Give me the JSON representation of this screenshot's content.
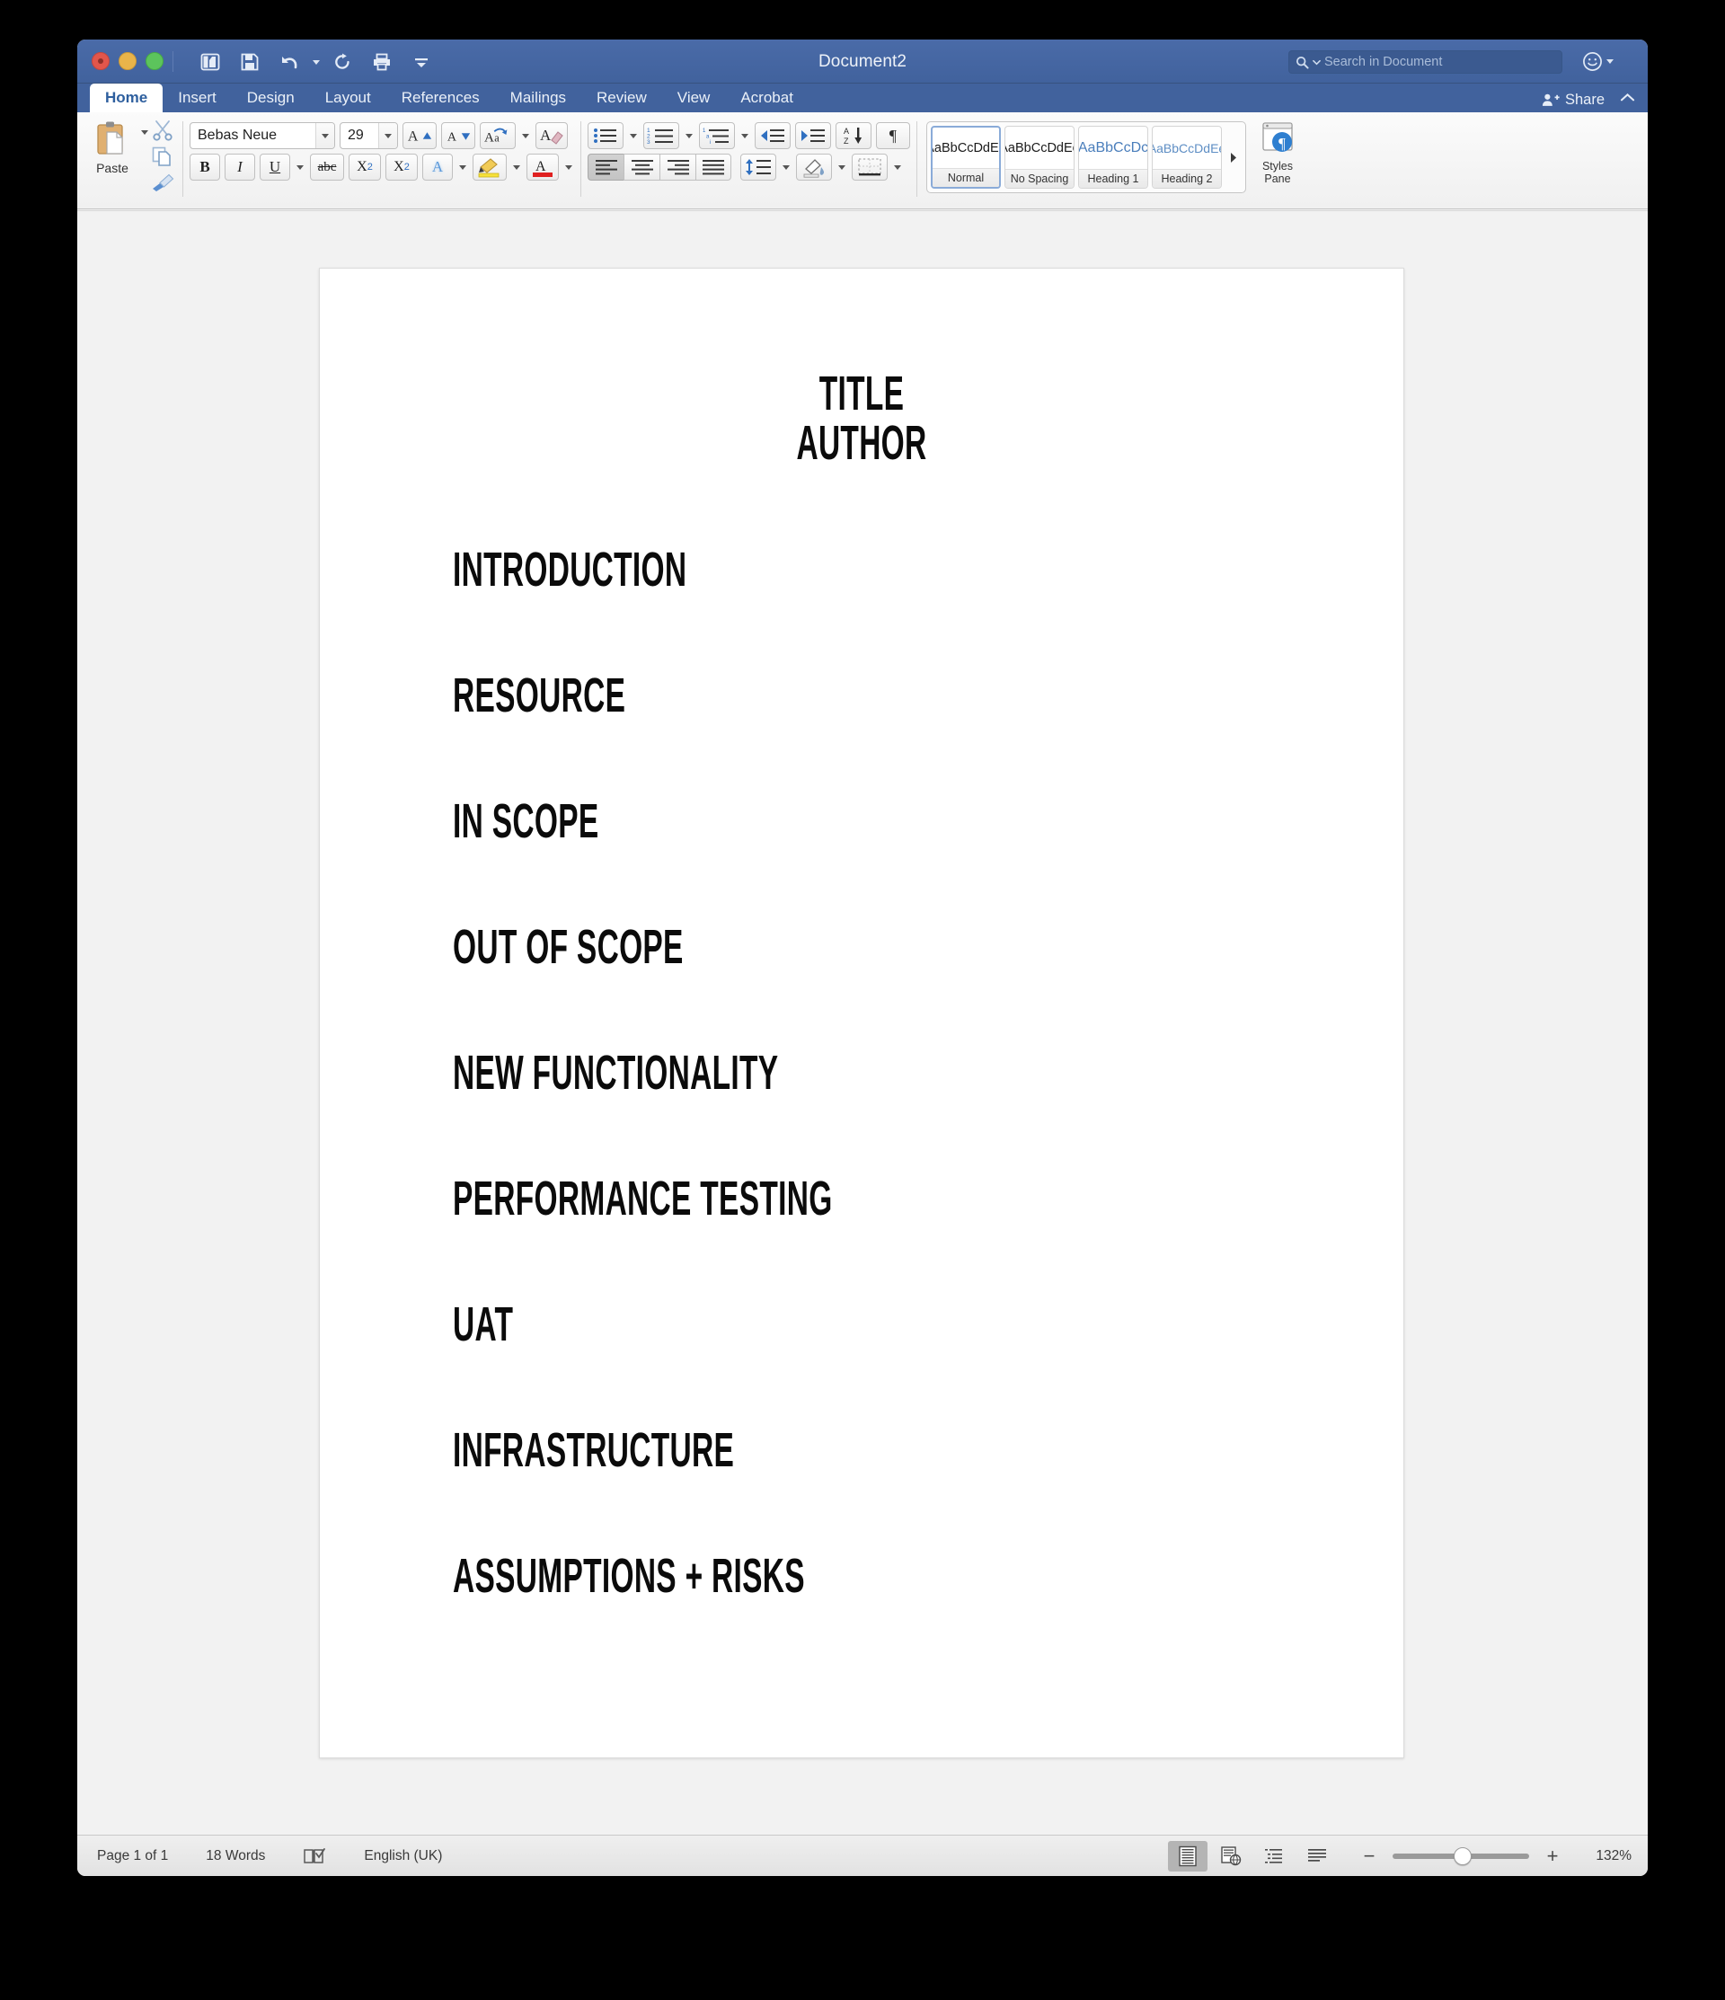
{
  "window": {
    "title": "Document2",
    "traffic_lights": [
      "close",
      "minimize",
      "zoom"
    ]
  },
  "quick_access": [
    {
      "name": "sidebar-toggle-icon",
      "label": "Sidebar"
    },
    {
      "name": "save-icon",
      "label": "Save"
    },
    {
      "name": "undo-icon",
      "label": "Undo"
    },
    {
      "name": "redo-icon",
      "label": "Redo"
    },
    {
      "name": "print-icon",
      "label": "Print"
    },
    {
      "name": "customize-toolbar-icon",
      "label": "Customize Toolbar"
    }
  ],
  "search": {
    "placeholder": "Search in Document",
    "value": ""
  },
  "account": {
    "smiley_icon": "smiley-icon"
  },
  "tabs": [
    {
      "label": "Home",
      "active": true
    },
    {
      "label": "Insert",
      "active": false
    },
    {
      "label": "Design",
      "active": false
    },
    {
      "label": "Layout",
      "active": false
    },
    {
      "label": "References",
      "active": false
    },
    {
      "label": "Mailings",
      "active": false
    },
    {
      "label": "Review",
      "active": false
    },
    {
      "label": "View",
      "active": false
    },
    {
      "label": "Acrobat",
      "active": false
    }
  ],
  "share": {
    "label": "Share"
  },
  "ribbon": {
    "clipboard": {
      "paste_label": "Paste",
      "cut_label": "Cut",
      "copy_label": "Copy",
      "format_painter_label": "Format Painter"
    },
    "font": {
      "family": "Bebas Neue",
      "size": "29",
      "grow_label": "Grow Font",
      "shrink_label": "Shrink Font",
      "change_case_label": "Change Case",
      "clear_formatting_label": "Clear Formatting",
      "bold_label": "B",
      "italic_label": "I",
      "underline_label": "U",
      "strikethrough_label": "abc",
      "subscript_label": "X",
      "subscript_sub": "2",
      "superscript_label": "X",
      "superscript_sup": "2",
      "text_effects_label": "A",
      "highlight_color": "#f7e13a",
      "font_color": "#e02020"
    },
    "paragraph": {
      "bullets_label": "Bullets",
      "numbering_label": "Numbering",
      "multilevel_label": "Multilevel List",
      "decrease_indent_label": "Decrease Indent",
      "increase_indent_label": "Increase Indent",
      "sort_label": "Sort",
      "show_marks_label": "Show Formatting Marks",
      "align_left_label": "Align Left",
      "align_center_label": "Center",
      "align_right_label": "Align Right",
      "justify_label": "Justify",
      "line_spacing_label": "Line Spacing",
      "shading_label": "Shading",
      "borders_label": "Borders"
    },
    "styles": {
      "items": [
        {
          "preview": "AaBbCcDdEe",
          "name": "Normal",
          "selected": true,
          "variant": "normal"
        },
        {
          "preview": "AaBbCcDdEe",
          "name": "No Spacing",
          "selected": false,
          "variant": "normal"
        },
        {
          "preview": "AaBbCcDc",
          "name": "Heading 1",
          "selected": false,
          "variant": "h1"
        },
        {
          "preview": "AaBbCcDdEe",
          "name": "Heading 2",
          "selected": false,
          "variant": "h2"
        }
      ],
      "more_label": "More Styles",
      "pane_label_line1": "Styles",
      "pane_label_line2": "Pane",
      "pane_badge": "1"
    }
  },
  "document": {
    "center_lines": [
      "TITLE",
      "AUTHOR"
    ],
    "headings": [
      "INTRODUCTION",
      "RESOURCE",
      "IN SCOPE",
      "OUT OF SCOPE",
      "NEW FUNCTIONALITY",
      "PERFORMANCE TESTING",
      "UAT",
      "INFRASTRUCTURE",
      "ASSUMPTIONS + RISKS"
    ]
  },
  "status": {
    "page": "Page 1 of 1",
    "words": "18 Words",
    "proofing_icon": "proofing-icon",
    "language": "English (UK)",
    "views": [
      {
        "name": "print-layout-view",
        "active": true
      },
      {
        "name": "web-layout-view",
        "active": false
      },
      {
        "name": "outline-view",
        "active": false
      },
      {
        "name": "draft-view",
        "active": false
      }
    ],
    "zoom_out_label": "−",
    "zoom_in_label": "+",
    "zoom_percent": "132%"
  }
}
